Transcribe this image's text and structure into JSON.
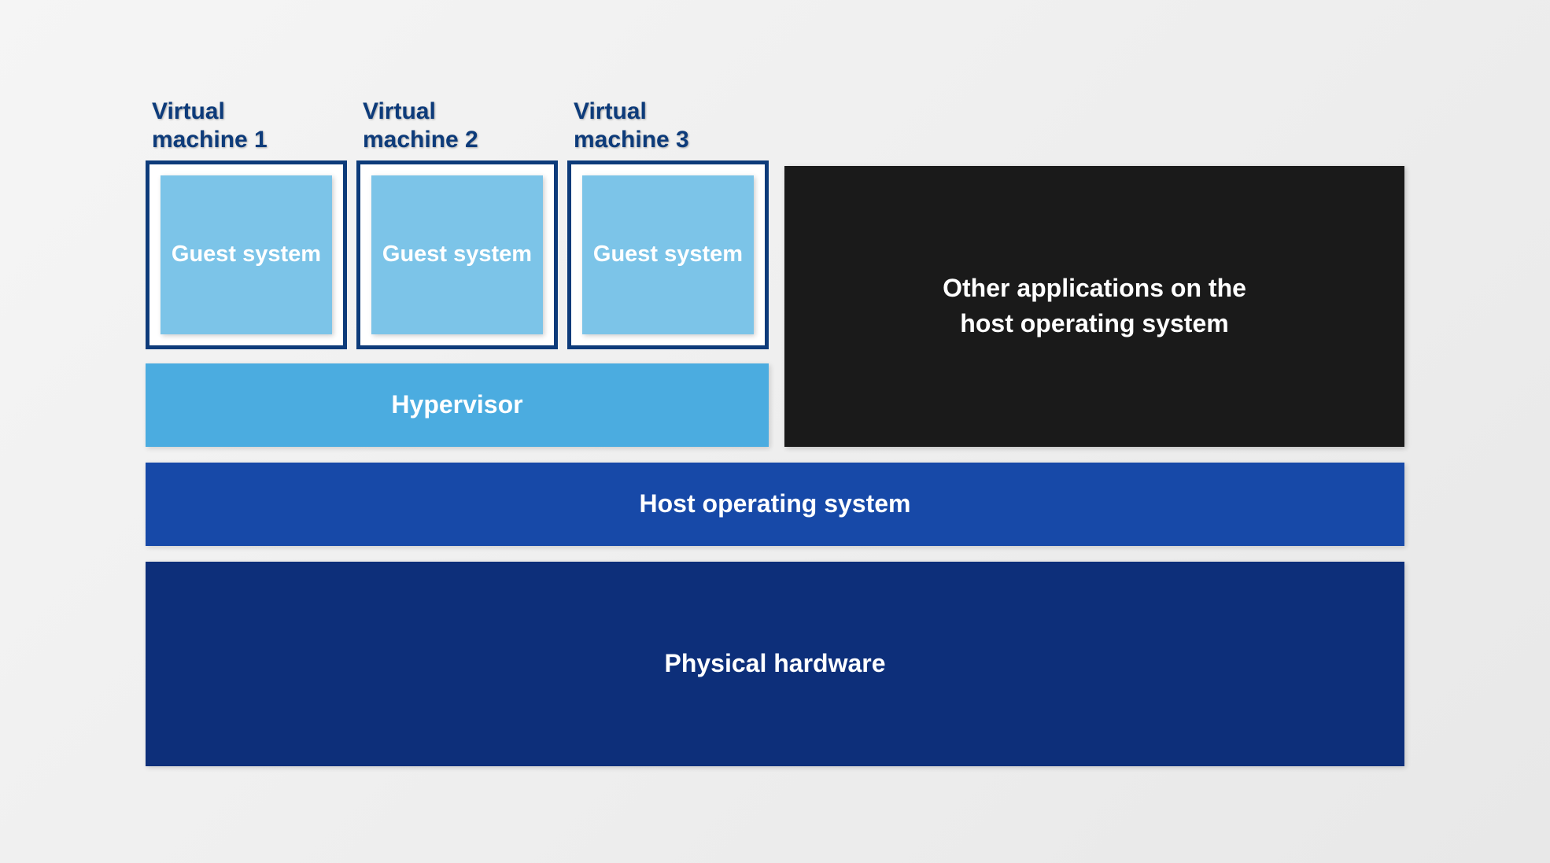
{
  "vms": [
    {
      "label_line1": "Virtual",
      "label_line2": "machine  1",
      "guest": "Guest system"
    },
    {
      "label_line1": "Virtual",
      "label_line2": "machine  2",
      "guest": "Guest system"
    },
    {
      "label_line1": "Virtual",
      "label_line2": "machine  3",
      "guest": "Guest system"
    }
  ],
  "hypervisor": "Hypervisor",
  "other_apps_line1": "Other applications on the",
  "other_apps_line2": "host operating system",
  "host_os": "Host operating system",
  "hardware": "Physical hardware"
}
